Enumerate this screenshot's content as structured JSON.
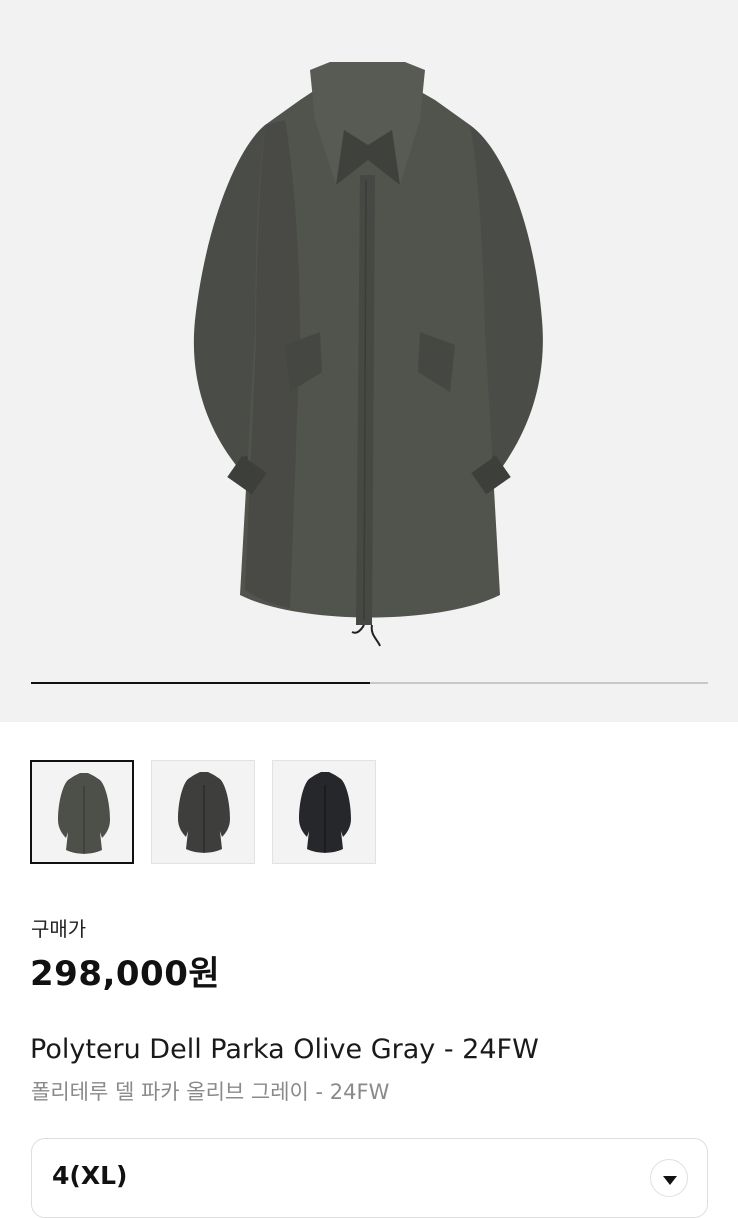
{
  "gallery": {
    "progress": 0.5,
    "thumbnails": [
      {
        "name": "olive-gray",
        "color": "#4d4f49",
        "selected": true
      },
      {
        "name": "charcoal",
        "color": "#3e3f3d",
        "selected": false
      },
      {
        "name": "black",
        "color": "#26272a",
        "selected": false
      }
    ]
  },
  "product": {
    "price_label": "구매가",
    "price": "298,000원",
    "title_en": "Polyteru Dell Parka Olive Gray - 24FW",
    "title_ko": "폴리테루 델 파카 올리브 그레이 - 24FW"
  },
  "option": {
    "selected_size": "4(XL)",
    "chevron_icon": "chevron-down-icon"
  }
}
